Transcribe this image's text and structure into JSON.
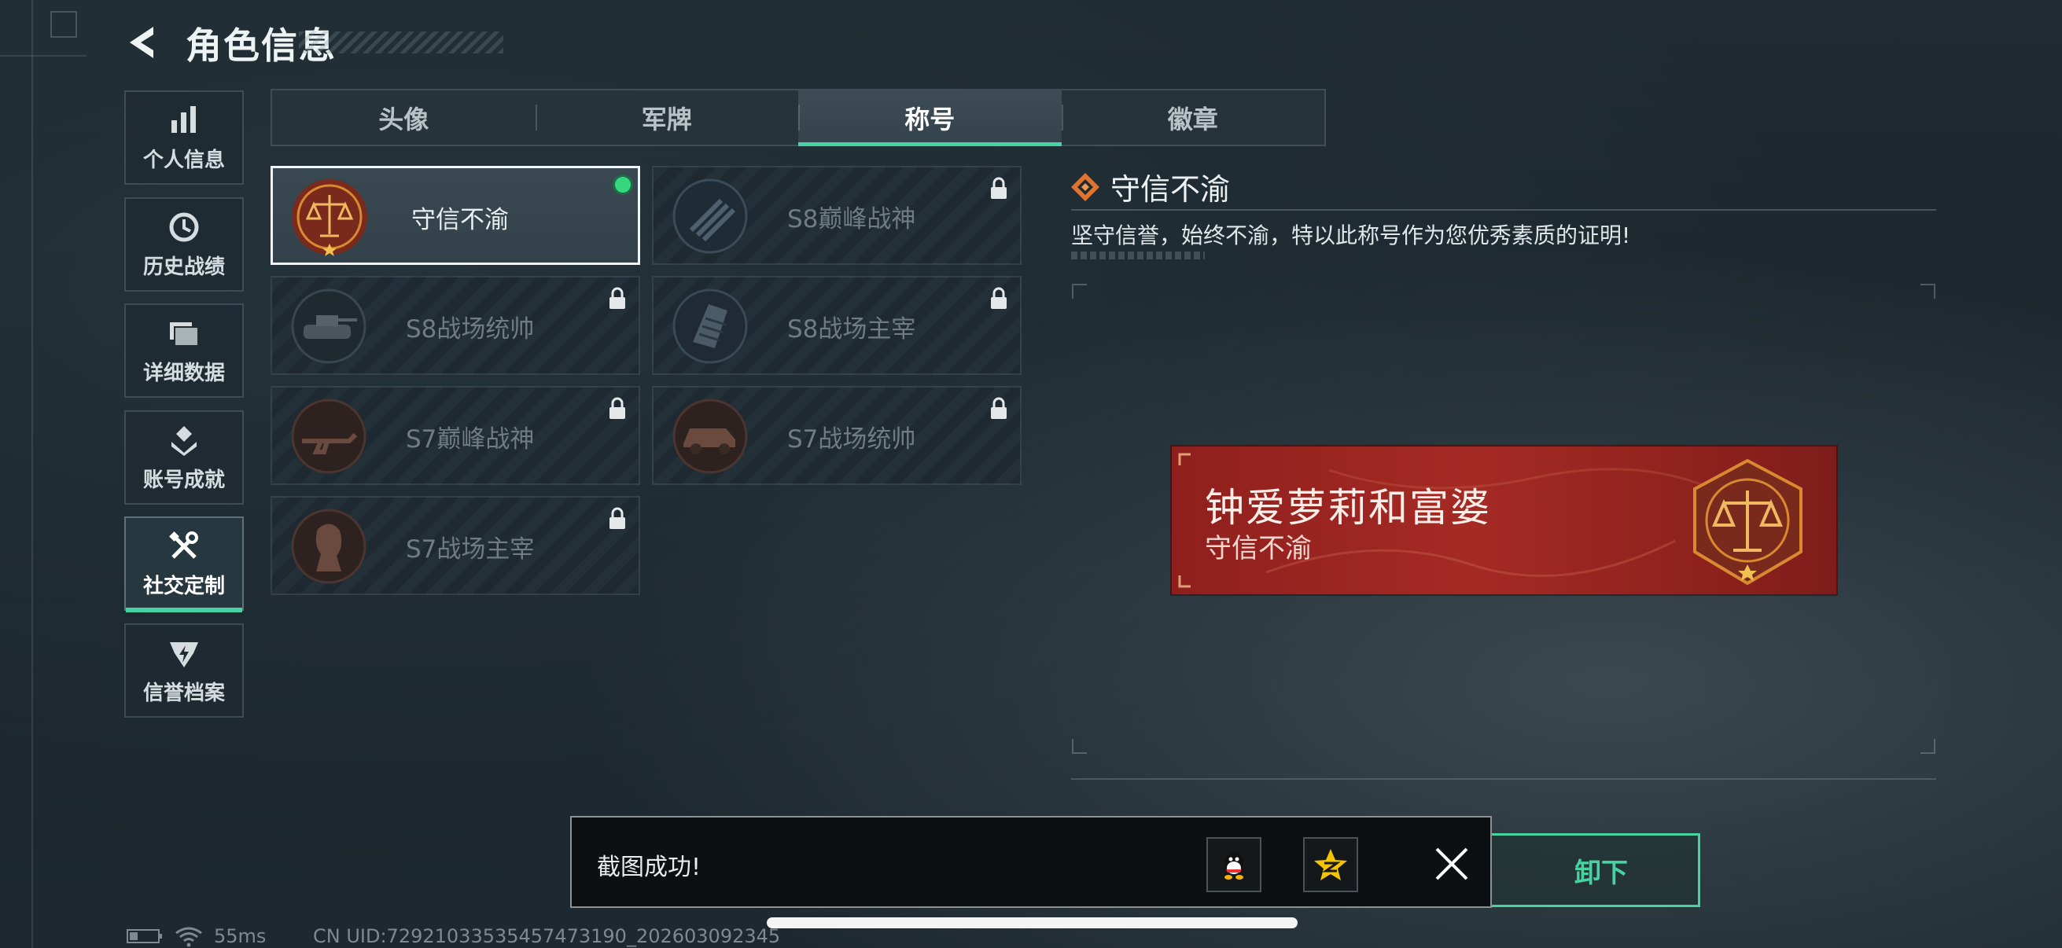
{
  "header": {
    "title": "角色信息"
  },
  "sidebar": {
    "items": [
      {
        "label": "个人信息",
        "icon": "bar-chart-icon"
      },
      {
        "label": "历史战绩",
        "icon": "history-clock-icon"
      },
      {
        "label": "详细数据",
        "icon": "folder-icon"
      },
      {
        "label": "账号成就",
        "icon": "achievement-icon"
      },
      {
        "label": "社交定制",
        "icon": "tools-icon",
        "active": true
      },
      {
        "label": "信誉档案",
        "icon": "reputation-icon"
      }
    ]
  },
  "tabs": [
    {
      "label": "头像"
    },
    {
      "label": "军牌"
    },
    {
      "label": "称号",
      "active": true
    },
    {
      "label": "徽章"
    }
  ],
  "titles": [
    {
      "name": "守信不渝",
      "equipped": true,
      "locked": false,
      "icon": "scales-emblem-icon"
    },
    {
      "name": "S8巅峰战神",
      "locked": true,
      "icon": "missile-emblem-icon"
    },
    {
      "name": "S8战场统帅",
      "locked": true,
      "icon": "tank-emblem-icon"
    },
    {
      "name": "S8战场主宰",
      "locked": true,
      "icon": "building-emblem-icon"
    },
    {
      "name": "S7巅峰战神",
      "locked": true,
      "icon": "weapon-emblem-icon"
    },
    {
      "name": "S7战场统帅",
      "locked": true,
      "icon": "vehicle-emblem-icon"
    },
    {
      "name": "S7战场主宰",
      "locked": true,
      "icon": "soldier-emblem-icon"
    }
  ],
  "detail": {
    "title": "守信不渝",
    "description": "坚守信誉，始终不渝，特以此称号作为您优秀素质的证明!",
    "banner_name": "钟爱萝莉和富婆",
    "banner_title": "守信不渝",
    "unequip_label": "卸下"
  },
  "toast": {
    "message": "截图成功!",
    "share_icons": [
      "qq-icon",
      "qzone-icon"
    ]
  },
  "status": {
    "ping": "55ms",
    "uid": "CN UID:72921033535457473190_202603092345"
  },
  "colors": {
    "accent": "#46d3a2",
    "banner_red": "#a52a24",
    "equipped_dot": "#35d67e"
  }
}
